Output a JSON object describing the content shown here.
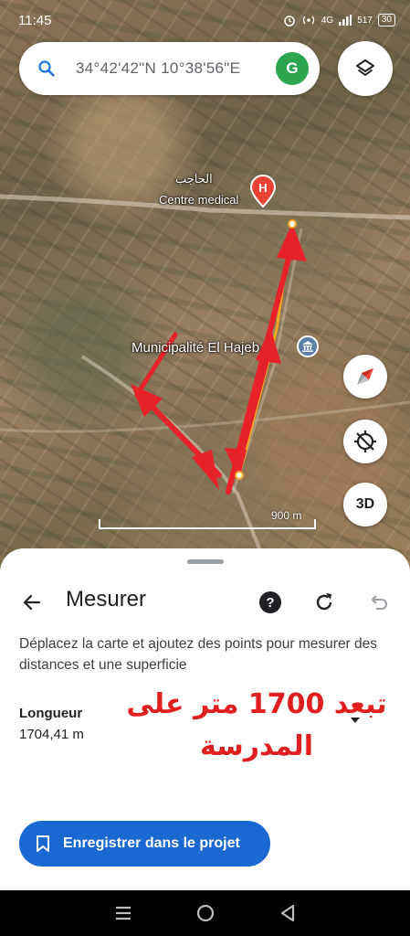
{
  "status_bar": {
    "time": "11:45",
    "network": "4G",
    "speed": "517",
    "battery": "30"
  },
  "search": {
    "coordinates": "34°42'42\"N 10°38'56\"E",
    "account_initial": "G"
  },
  "map": {
    "poi_arabic": "الحاجب",
    "poi_medical": "Centre medical",
    "poi_municipality": "Municipalité El Hajeb",
    "scale_label": "900 m",
    "btn_3d": "3D"
  },
  "sheet": {
    "title": "Mesurer",
    "instructions": "Déplacez la carte et ajoutez des points pour mesurer des distances et une superficie",
    "length_label": "Longueur",
    "length_value": "1704,41 m",
    "annotation": "تبعد 1700 متر على المدرسة",
    "save_label": "Enregistrer dans le projet"
  },
  "colors": {
    "accent": "#1a68d1",
    "annotation": "#e02020",
    "measure_line": "#f5a623",
    "arrow": "#e8222a"
  }
}
